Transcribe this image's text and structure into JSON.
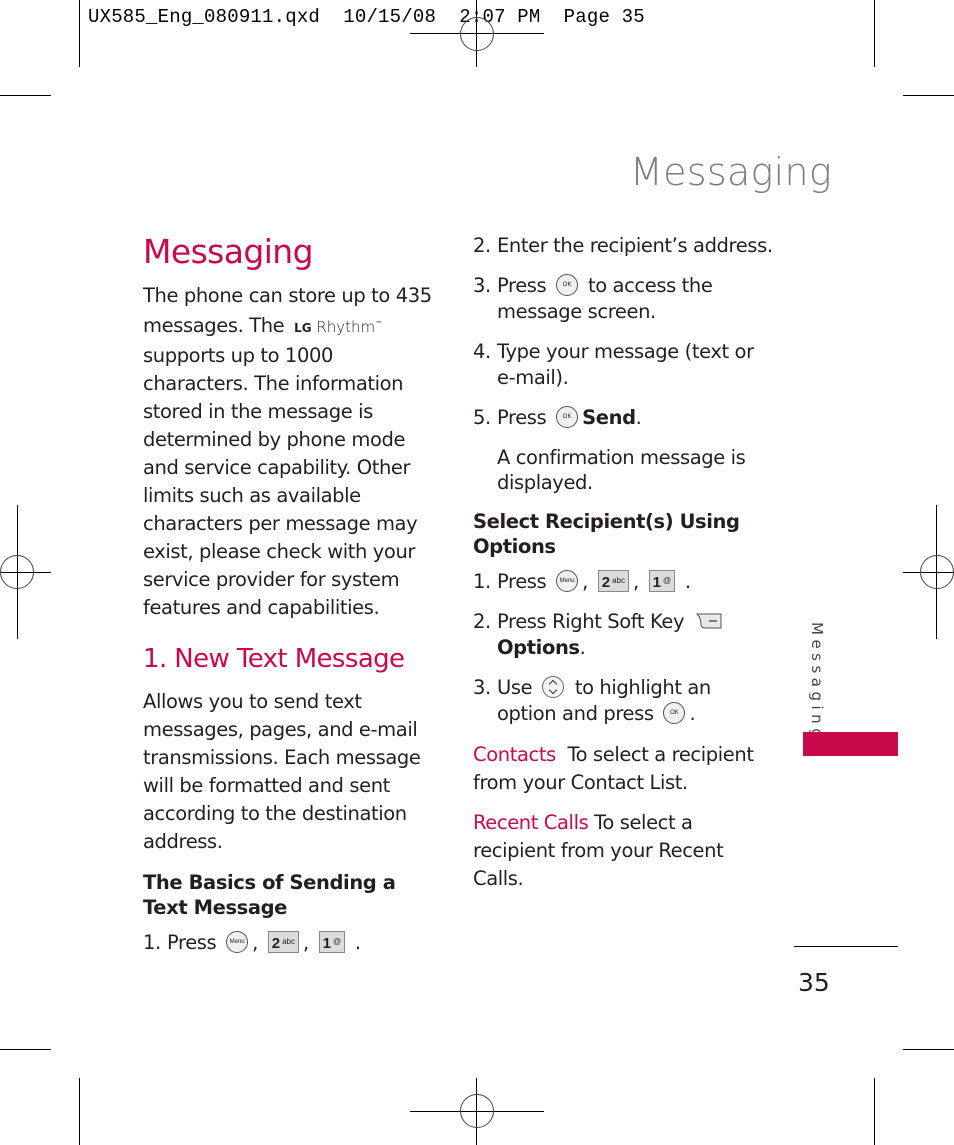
{
  "slug": {
    "text": "UX585_Eng_080911.qxd  10/15/08  2:07 PM  Page 35"
  },
  "running_header": {
    "title": "Messaging"
  },
  "side_tab": {
    "label": "Messaging",
    "accent_color": "#c8094b"
  },
  "page_number": "35",
  "left_column": {
    "heading": "Messaging",
    "intro_part1": "The phone can store up to 435 messages. The",
    "logo": {
      "brand": "LG",
      "model": "Rhythm",
      "mark": "™"
    },
    "intro_part2": "supports up to 1000 characters. The information stored in the message is determined by phone mode and service capability. Other limits such as available characters per message may exist, please check with your service provider for system features and capabilities.",
    "subheading": "1. New Text Message",
    "description": "Allows you to send text messages, pages, and e-mail transmissions. Each message will be formatted and sent according to the destination address.",
    "basics_heading": "The Basics of Sending a Text Message",
    "step1": {
      "num": "1.",
      "text": "Press",
      "keys": {
        "menu": "Menu",
        "key2_big": "2",
        "key2_small": "abc",
        "key1_big": "1",
        "key1_small": "@"
      },
      "sep": ",",
      "end": "."
    }
  },
  "right_column": {
    "steps": [
      {
        "num": "2.",
        "text": "Enter the recipient’s address."
      },
      {
        "num": "3.",
        "pre": "Press",
        "key": "OK",
        "post": "to access the message screen."
      },
      {
        "num": "4.",
        "text": "Type your message (text or e-mail)."
      },
      {
        "num": "5.",
        "pre": "Press",
        "key": "OK",
        "bold": "Send",
        "post": "."
      }
    ],
    "confirmation_note": "A confirmation message is displayed.",
    "options_heading": "Select Recipient(s) Using Options",
    "option_steps": [
      {
        "num": "1.",
        "pre": "Press",
        "menu_key": "Menu",
        "key2_big": "2",
        "key2_small": "abc",
        "key1_big": "1",
        "key1_small": "@",
        "sep": ",",
        "end": "."
      },
      {
        "num": "2.",
        "pre": "Press Right Soft Key",
        "bold": "Options",
        "post": "."
      },
      {
        "num": "3.",
        "pre": "Use",
        "mid": "to highlight an option and press",
        "key": "OK",
        "end": "."
      }
    ],
    "options": [
      {
        "name": "Contacts",
        "desc": "To select a recipient from your Contact List."
      },
      {
        "name": "Recent Calls",
        "desc": "To select a recipient from your Recent Calls."
      }
    ]
  }
}
